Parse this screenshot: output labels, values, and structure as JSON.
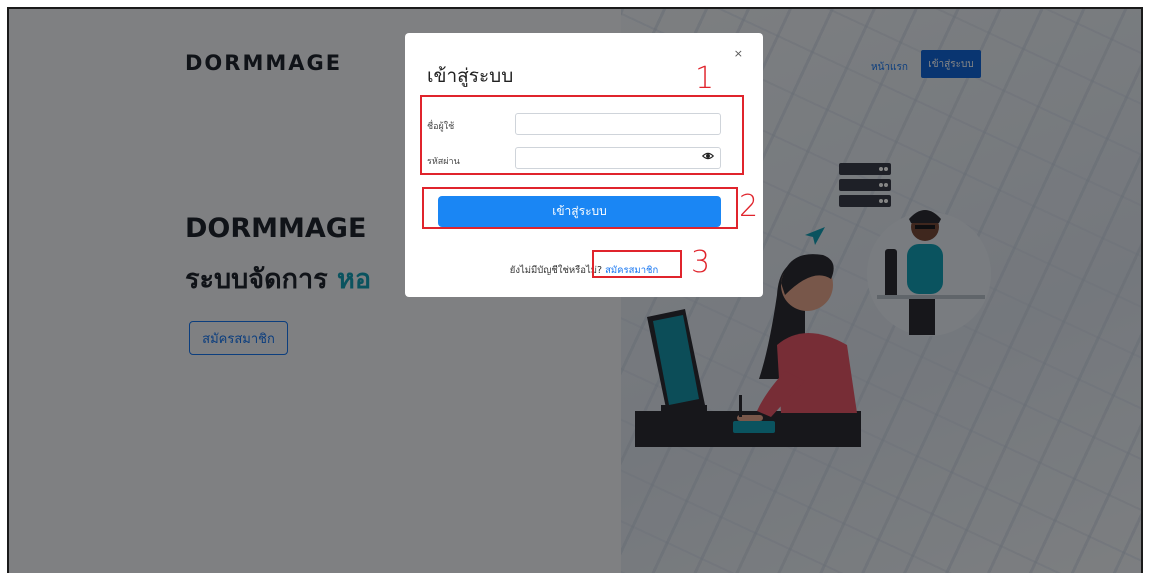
{
  "background": {
    "brand": "DORMMAGE",
    "nav_home": "หน้าแรก",
    "nav_login": "เข้าสู่ระบบ",
    "hero_title": "DORMMAGE",
    "hero_sub_prefix": "ระบบจัดการ ",
    "hero_sub_accent": "หอ",
    "hero_button": "สมัครสมาชิก"
  },
  "modal": {
    "title": "เข้าสู่ระบบ",
    "close": "×",
    "username_label": "ชื่อผู้ใช้",
    "username_value": "",
    "password_label": "รหัสผ่าน",
    "password_value": "",
    "submit_label": "เข้าสู่ระบบ",
    "signup_prompt": "ยังไม่มีบัญชีใช่หรือไม่?",
    "signup_link": "สมัครสมาชิก"
  },
  "annotations": [
    "1",
    "2",
    "3"
  ],
  "colors": {
    "primary": "#1a86f4",
    "accent": "#15a0b7",
    "annotation": "#e0242c"
  }
}
